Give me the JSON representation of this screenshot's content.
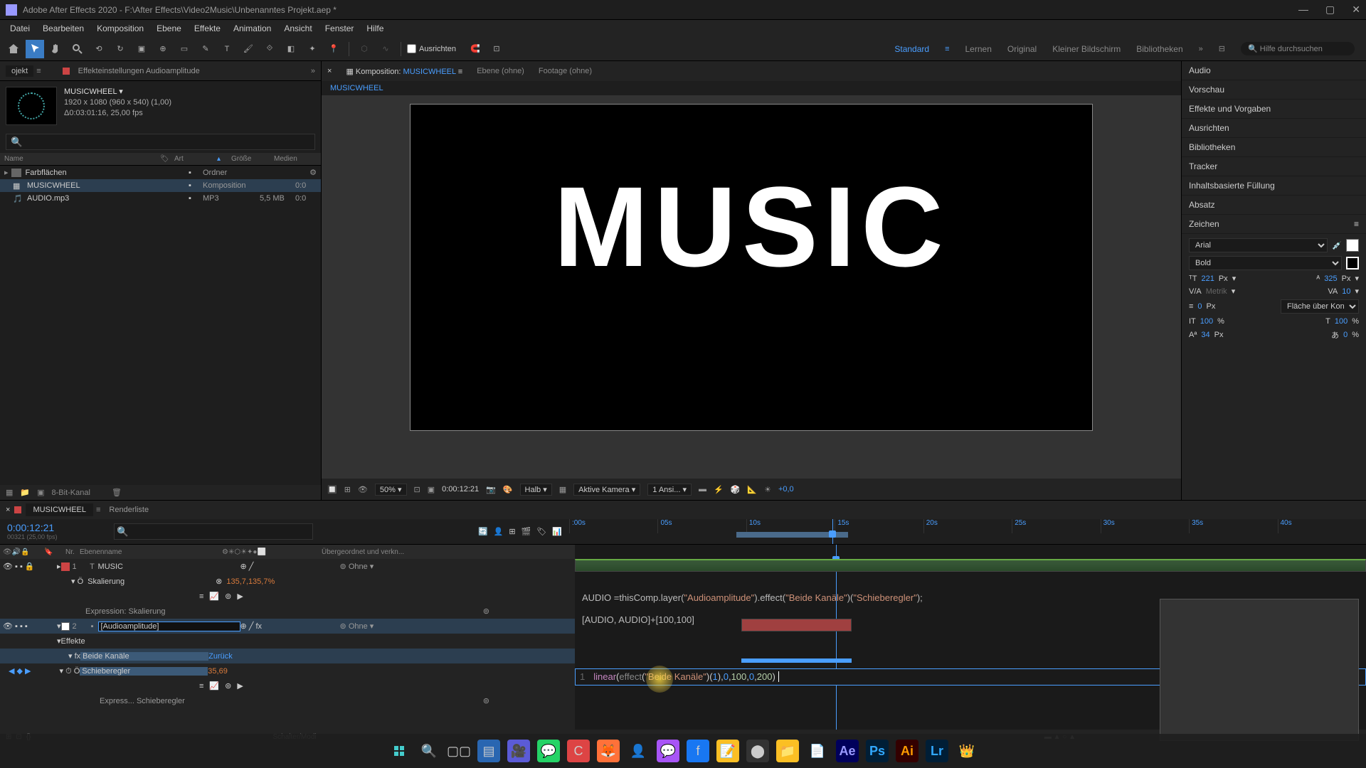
{
  "titlebar": {
    "title": "Adobe After Effects 2020 - F:\\After Effects\\Video2Music\\Unbenanntes Projekt.aep *"
  },
  "menubar": [
    "Datei",
    "Bearbeiten",
    "Komposition",
    "Ebene",
    "Effekte",
    "Animation",
    "Ansicht",
    "Fenster",
    "Hilfe"
  ],
  "toolbar": {
    "align_label": "Ausrichten",
    "workspaces": [
      "Standard",
      "Lernen",
      "Original",
      "Kleiner Bildschirm",
      "Bibliotheken"
    ],
    "search_placeholder": "Hilfe durchsuchen"
  },
  "project": {
    "tab": "ojekt",
    "effects_label": "Effekteinstellungen Audioamplitude",
    "comp_name": "MUSICWHEEL",
    "resolution": "1920 x 1080 (960 x 540) (1,00)",
    "duration": "Δ0:03:01:16, 25,00 fps",
    "cols": {
      "name": "Name",
      "art": "Art",
      "size": "Größe",
      "media": "Medien"
    },
    "items": [
      {
        "name": "Farbflächen",
        "art": "Ordner",
        "size": "",
        "media": ""
      },
      {
        "name": "MUSICWHEEL",
        "art": "Komposition",
        "size": "",
        "media": "0:0"
      },
      {
        "name": "AUDIO.mp3",
        "art": "MP3",
        "size": "5,5 MB",
        "media": "0:0"
      }
    ],
    "bottom_label": "8-Bit-Kanal"
  },
  "composition": {
    "tab_comp": "Komposition:",
    "tab_comp_name": "MUSICWHEEL",
    "tab_ebene": "Ebene (ohne)",
    "tab_footage": "Footage (ohne)",
    "breadcrumb": "MUSICWHEEL",
    "canvas_text": "MUSIC",
    "controls": {
      "zoom": "50%",
      "timecode": "0:00:12:21",
      "resolution": "Halb",
      "camera": "Aktive Kamera",
      "views": "1 Ansi...",
      "exposure": "+0,0"
    }
  },
  "right_panels": {
    "items": [
      "Audio",
      "Vorschau",
      "Effekte und Vorgaben",
      "Ausrichten",
      "Bibliotheken",
      "Tracker",
      "Inhaltsbasierte Füllung",
      "Absatz"
    ],
    "character": {
      "title": "Zeichen",
      "font": "Arial",
      "style": "Bold",
      "size": "221",
      "size_unit": "Px",
      "leading": "325",
      "kerning": "Metrik",
      "tracking": "10",
      "stroke": "0",
      "stroke_unit": "Px",
      "stroke_mode": "Fläche über Kon...",
      "vscale": "100",
      "hscale": "100",
      "baseline": "34",
      "tsume": "0",
      "pct": "%"
    }
  },
  "timeline": {
    "tab": "MUSICWHEEL",
    "tab2": "Renderliste",
    "timecode": "0:00:12:21",
    "sub": "00321 (25,00 fps)",
    "ruler": [
      ":00s",
      "05s",
      "10s",
      "15s",
      "20s",
      "25s",
      "30s",
      "35s",
      "40s"
    ],
    "cols": {
      "nr": "Nr.",
      "name": "Ebenenname",
      "parent": "Übergeordnet und verkn..."
    },
    "layers": {
      "l1": {
        "num": "1",
        "name": "MUSIC",
        "parent": "Ohne"
      },
      "l1_scale": {
        "name": "Skalierung",
        "value": "135,7,135,7%"
      },
      "l1_expr": "Expression: Skalierung",
      "l2": {
        "num": "2",
        "name": "[Audioamplitude]",
        "parent": "Ohne"
      },
      "l2_fx": "Effekte",
      "l2_both": "Beide Kanäle",
      "l2_reset": "Zurück",
      "l2_slider": "Schieberegler",
      "l2_slider_val": "35,69",
      "l2_slider_expr": "Express... Schieberegler"
    },
    "expr1_pre": "AUDIO =thisComp.layer(",
    "expr1_str1": "\"Audioamplitude\"",
    "expr1_mid1": ").effect(",
    "expr1_str2": "\"Beide Kanäle\"",
    "expr1_mid2": ")(",
    "expr1_str3": "\"Schieberegler\"",
    "expr1_end": ");",
    "expr1_line2": "[AUDIO, AUDIO]+[100,100]",
    "expr2": {
      "ln": "1",
      "linear": "linear",
      "p1": "(",
      "effect": "effect",
      "p2": "(",
      "str": "\"Beide Kanäle\"",
      "p3": ")(",
      "n1": "1",
      "p4": "),",
      "n2": "0",
      "c1": ",",
      "n3": "100",
      "c2": ",",
      "n4": "0",
      "c3": ",",
      "n5": "200",
      "p5": ")"
    },
    "footer": "Schalter/Modi"
  },
  "taskbar": {
    "items": [
      "windows",
      "search",
      "tasks",
      "explorer",
      "video",
      "whatsapp",
      "ccleaner",
      "firefox",
      "anydesk",
      "messenger",
      "facebook",
      "notes",
      "obs",
      "files",
      "editor",
      "ae",
      "ps",
      "ai",
      "lr",
      "misc"
    ]
  }
}
